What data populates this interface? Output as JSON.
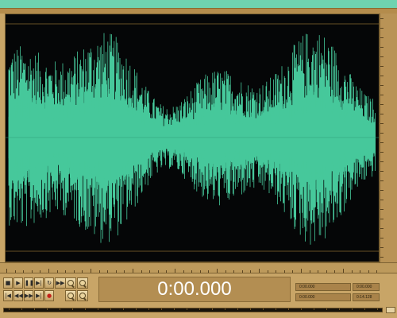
{
  "colors": {
    "waveform": "#46c89b",
    "waveform_dim": "#2f9d79",
    "background": "#050607",
    "chrome": "#c8a567",
    "accent_top": "#6fd3b0"
  },
  "waveform": {
    "description_icon": "waveform-display"
  },
  "transport": {
    "buttons_row1": [
      {
        "name": "stop",
        "glyph": "■"
      },
      {
        "name": "play",
        "glyph": "▶"
      },
      {
        "name": "pause",
        "glyph": "❚❚"
      },
      {
        "name": "play-to-end",
        "glyph": "▶|"
      },
      {
        "name": "loop",
        "glyph": "↻"
      },
      {
        "name": "play-from-cursor",
        "glyph": "▶▶"
      }
    ],
    "buttons_row2": [
      {
        "name": "go-to-start",
        "glyph": "|◀"
      },
      {
        "name": "rewind",
        "glyph": "◀◀"
      },
      {
        "name": "fast-forward",
        "glyph": "▶▶"
      },
      {
        "name": "go-to-end",
        "glyph": "▶|"
      },
      {
        "name": "record",
        "glyph": "●"
      }
    ],
    "time": "0:00.000"
  },
  "selection": {
    "begin": "0:00.000",
    "end": "0:00.000",
    "length": "0:00.000",
    "view_begin": "0:00.000",
    "view_end": "0:14.128",
    "view_length": "0:14.128"
  }
}
